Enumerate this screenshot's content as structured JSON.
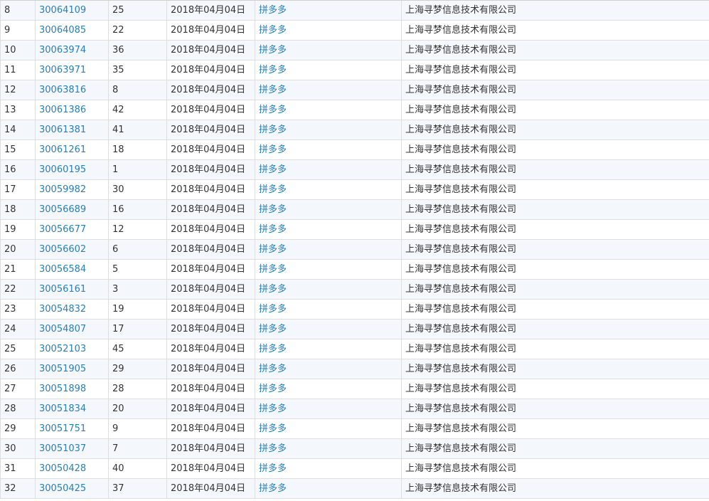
{
  "table": {
    "rows": [
      {
        "index": "8",
        "reg_no": "30064109",
        "class": "25",
        "date": "2018年04月04日",
        "name": "拼多多",
        "applicant": "上海寻梦信息技术有限公司"
      },
      {
        "index": "9",
        "reg_no": "30064085",
        "class": "22",
        "date": "2018年04月04日",
        "name": "拼多多",
        "applicant": "上海寻梦信息技术有限公司"
      },
      {
        "index": "10",
        "reg_no": "30063974",
        "class": "36",
        "date": "2018年04月04日",
        "name": "拼多多",
        "applicant": "上海寻梦信息技术有限公司"
      },
      {
        "index": "11",
        "reg_no": "30063971",
        "class": "35",
        "date": "2018年04月04日",
        "name": "拼多多",
        "applicant": "上海寻梦信息技术有限公司"
      },
      {
        "index": "12",
        "reg_no": "30063816",
        "class": "8",
        "date": "2018年04月04日",
        "name": "拼多多",
        "applicant": "上海寻梦信息技术有限公司"
      },
      {
        "index": "13",
        "reg_no": "30061386",
        "class": "42",
        "date": "2018年04月04日",
        "name": "拼多多",
        "applicant": "上海寻梦信息技术有限公司"
      },
      {
        "index": "14",
        "reg_no": "30061381",
        "class": "41",
        "date": "2018年04月04日",
        "name": "拼多多",
        "applicant": "上海寻梦信息技术有限公司"
      },
      {
        "index": "15",
        "reg_no": "30061261",
        "class": "18",
        "date": "2018年04月04日",
        "name": "拼多多",
        "applicant": "上海寻梦信息技术有限公司"
      },
      {
        "index": "16",
        "reg_no": "30060195",
        "class": "1",
        "date": "2018年04月04日",
        "name": "拼多多",
        "applicant": "上海寻梦信息技术有限公司"
      },
      {
        "index": "17",
        "reg_no": "30059982",
        "class": "30",
        "date": "2018年04月04日",
        "name": "拼多多",
        "applicant": "上海寻梦信息技术有限公司"
      },
      {
        "index": "18",
        "reg_no": "30056689",
        "class": "16",
        "date": "2018年04月04日",
        "name": "拼多多",
        "applicant": "上海寻梦信息技术有限公司"
      },
      {
        "index": "19",
        "reg_no": "30056677",
        "class": "12",
        "date": "2018年04月04日",
        "name": "拼多多",
        "applicant": "上海寻梦信息技术有限公司"
      },
      {
        "index": "20",
        "reg_no": "30056602",
        "class": "6",
        "date": "2018年04月04日",
        "name": "拼多多",
        "applicant": "上海寻梦信息技术有限公司"
      },
      {
        "index": "21",
        "reg_no": "30056584",
        "class": "5",
        "date": "2018年04月04日",
        "name": "拼多多",
        "applicant": "上海寻梦信息技术有限公司"
      },
      {
        "index": "22",
        "reg_no": "30056161",
        "class": "3",
        "date": "2018年04月04日",
        "name": "拼多多",
        "applicant": "上海寻梦信息技术有限公司"
      },
      {
        "index": "23",
        "reg_no": "30054832",
        "class": "19",
        "date": "2018年04月04日",
        "name": "拼多多",
        "applicant": "上海寻梦信息技术有限公司"
      },
      {
        "index": "24",
        "reg_no": "30054807",
        "class": "17",
        "date": "2018年04月04日",
        "name": "拼多多",
        "applicant": "上海寻梦信息技术有限公司"
      },
      {
        "index": "25",
        "reg_no": "30052103",
        "class": "45",
        "date": "2018年04月04日",
        "name": "拼多多",
        "applicant": "上海寻梦信息技术有限公司"
      },
      {
        "index": "26",
        "reg_no": "30051905",
        "class": "29",
        "date": "2018年04月04日",
        "name": "拼多多",
        "applicant": "上海寻梦信息技术有限公司"
      },
      {
        "index": "27",
        "reg_no": "30051898",
        "class": "28",
        "date": "2018年04月04日",
        "name": "拼多多",
        "applicant": "上海寻梦信息技术有限公司"
      },
      {
        "index": "28",
        "reg_no": "30051834",
        "class": "20",
        "date": "2018年04月04日",
        "name": "拼多多",
        "applicant": "上海寻梦信息技术有限公司"
      },
      {
        "index": "29",
        "reg_no": "30051751",
        "class": "9",
        "date": "2018年04月04日",
        "name": "拼多多",
        "applicant": "上海寻梦信息技术有限公司"
      },
      {
        "index": "30",
        "reg_no": "30051037",
        "class": "7",
        "date": "2018年04月04日",
        "name": "拼多多",
        "applicant": "上海寻梦信息技术有限公司"
      },
      {
        "index": "31",
        "reg_no": "30050428",
        "class": "40",
        "date": "2018年04月04日",
        "name": "拼多多",
        "applicant": "上海寻梦信息技术有限公司"
      },
      {
        "index": "32",
        "reg_no": "30050425",
        "class": "37",
        "date": "2018年04月04日",
        "name": "拼多多",
        "applicant": "上海寻梦信息技术有限公司"
      }
    ]
  },
  "colors": {
    "link": "#2a7fb8",
    "text": "#333333",
    "row_alt_bg": "#f4f7fb",
    "border": "#dedede"
  }
}
